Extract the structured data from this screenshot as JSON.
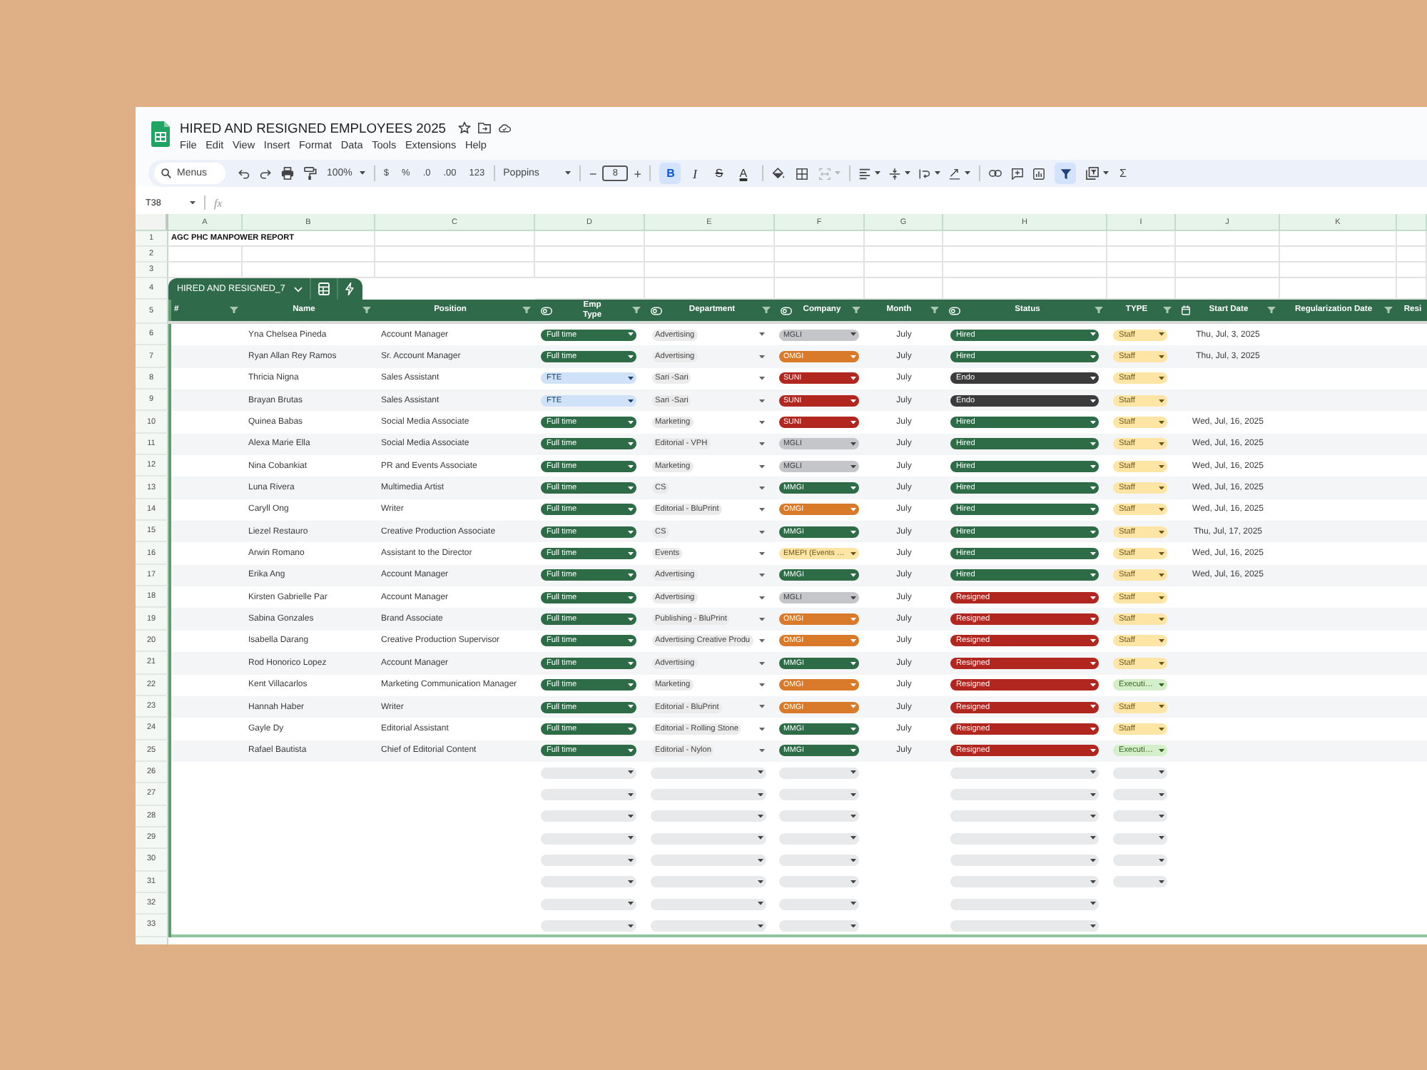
{
  "window": {
    "title": "HIRED AND RESIGNED EMPLOYEES 2025"
  },
  "menu": [
    "File",
    "Edit",
    "View",
    "Insert",
    "Format",
    "Data",
    "Tools",
    "Extensions",
    "Help"
  ],
  "toolbar": {
    "search": {
      "placeholder": "Menus"
    },
    "zoom": "100%",
    "currency": "$",
    "percent": "%",
    "decimal_decrease": ".0",
    "decimal_increase": ".00",
    "number_format": "123",
    "font": "Poppins",
    "minus": "−",
    "font_size": "8",
    "plus": "+",
    "format_buttons": [
      {
        "label": "B",
        "kind": "bold",
        "selected": true
      },
      {
        "label": "I",
        "kind": "italic",
        "selected": false
      },
      {
        "label": "S",
        "kind": "strike",
        "selected": false
      },
      {
        "label": "A",
        "kind": "color",
        "selected": false
      }
    ],
    "merge": {
      "disabled": true
    },
    "filter": {
      "selected": true
    },
    "sum": "Σ"
  },
  "formula_bar": {
    "cell": "T38",
    "fx": "fx"
  },
  "sheet": {
    "columns": [
      "A",
      "B",
      "C",
      "D",
      "E",
      "F",
      "G",
      "H",
      "I",
      "J",
      "K"
    ],
    "title_row": {
      "number": "1",
      "text": "AGC PHC MANPOWER REPORT"
    },
    "empty_rows": [
      "2",
      "3"
    ],
    "table": {
      "tab_row": "4",
      "name": "HIRED AND RESIGNED_7",
      "header_row": "5",
      "headers": [
        {
          "label": "#",
          "kind": "plain",
          "filter": true
        },
        {
          "label": "Name",
          "kind": "plain",
          "filter": true
        },
        {
          "label": "Position",
          "kind": "plain",
          "filter": true
        },
        {
          "label": "Emp Type",
          "kind": "dropdown",
          "filter": true
        },
        {
          "label": "Department",
          "kind": "dropdown",
          "filter": true
        },
        {
          "label": "Company",
          "kind": "dropdown",
          "filter": true
        },
        {
          "label": "Month",
          "kind": "plain",
          "filter": true
        },
        {
          "label": "Status",
          "kind": "dropdown",
          "filter": true
        },
        {
          "label": "TYPE",
          "kind": "plain",
          "filter": true
        },
        {
          "label": "Start Date",
          "kind": "date",
          "filter": true
        },
        {
          "label": "Regularization Date",
          "kind": "plain",
          "filter": true
        },
        {
          "label": "Resi",
          "kind": "plain",
          "filter": false
        }
      ],
      "rows": [
        {
          "number": "6",
          "kind": "entry",
          "name": "Yna Chelsea Pineda",
          "position": "Account Manager",
          "emp_type": {
            "text": "Full time",
            "color": "#2e6c48"
          },
          "department": "Advertising",
          "company": {
            "text": "MGLI",
            "color": "#c5c6c9"
          },
          "month": "July",
          "status": {
            "text": "Hired",
            "color": "#2e6c48"
          },
          "type": {
            "text": "Staff",
            "color": "#fde6a5"
          },
          "start_date": "Thu, Jul, 3, 2025"
        },
        {
          "number": "7",
          "kind": "entry",
          "name": "Ryan Allan Rey Ramos",
          "position": "Sr. Account Manager",
          "emp_type": {
            "text": "Full time",
            "color": "#2e6c48"
          },
          "department": "Advertising",
          "company": {
            "text": "OMGI",
            "color": "#d97a2b"
          },
          "month": "July",
          "status": {
            "text": "Hired",
            "color": "#2e6c48"
          },
          "type": {
            "text": "Staff",
            "color": "#fde6a5"
          },
          "start_date": "Thu, Jul, 3, 2025"
        },
        {
          "number": "8",
          "kind": "entry",
          "name": "Thricia Nigna",
          "position": "Sales Assistant",
          "emp_type": {
            "text": "FTE",
            "color": "#cfe2f8"
          },
          "department": "Sari -Sari",
          "company": {
            "text": "SUNI",
            "color": "#b1261f"
          },
          "month": "July",
          "status": {
            "text": "Endo",
            "color": "#3b3b3b"
          },
          "type": {
            "text": "Staff",
            "color": "#fde6a5"
          }
        },
        {
          "number": "9",
          "kind": "entry",
          "name": "Brayan Brutas",
          "position": "Sales Assistant",
          "emp_type": {
            "text": "FTE",
            "color": "#cfe2f8"
          },
          "department": "Sari -Sari",
          "company": {
            "text": "SUNI",
            "color": "#b1261f"
          },
          "month": "July",
          "status": {
            "text": "Endo",
            "color": "#3b3b3b"
          },
          "type": {
            "text": "Staff",
            "color": "#fde6a5"
          }
        },
        {
          "number": "10",
          "kind": "entry",
          "name": "Quinea Babas",
          "position": "Social Media Associate",
          "emp_type": {
            "text": "Full time",
            "color": "#2e6c48"
          },
          "department": "Marketing",
          "company": {
            "text": "SUNI",
            "color": "#b1261f"
          },
          "month": "July",
          "status": {
            "text": "Hired",
            "color": "#2e6c48"
          },
          "type": {
            "text": "Staff",
            "color": "#fde6a5"
          },
          "start_date": "Wed, Jul, 16, 2025"
        },
        {
          "number": "11",
          "kind": "entry",
          "name": "Alexa Marie Ella",
          "position": "Social Media Associate",
          "emp_type": {
            "text": "Full time",
            "color": "#2e6c48"
          },
          "department": "Editorial - VPH",
          "company": {
            "text": "MGLI",
            "color": "#c5c6c9"
          },
          "month": "July",
          "status": {
            "text": "Hired",
            "color": "#2e6c48"
          },
          "type": {
            "text": "Staff",
            "color": "#fde6a5"
          },
          "start_date": "Wed, Jul, 16, 2025"
        },
        {
          "number": "12",
          "kind": "entry",
          "name": "Nina Cobankiat",
          "position": "PR and Events Associate",
          "emp_type": {
            "text": "Full time",
            "color": "#2e6c48"
          },
          "department": "Marketing",
          "company": {
            "text": "MGLI",
            "color": "#c5c6c9"
          },
          "month": "July",
          "status": {
            "text": "Hired",
            "color": "#2e6c48"
          },
          "type": {
            "text": "Staff",
            "color": "#fde6a5"
          },
          "start_date": "Wed, Jul, 16, 2025"
        },
        {
          "number": "13",
          "kind": "entry",
          "name": "Luna Rivera",
          "position": "Multimedia Artist",
          "emp_type": {
            "text": "Full time",
            "color": "#2e6c48"
          },
          "department": "CS",
          "company": {
            "text": "MMGI",
            "color": "#2e6c48"
          },
          "month": "July",
          "status": {
            "text": "Hired",
            "color": "#2e6c48"
          },
          "type": {
            "text": "Staff",
            "color": "#fde6a5"
          },
          "start_date": "Wed, Jul, 16, 2025"
        },
        {
          "number": "14",
          "kind": "entry",
          "name": "Caryll Ong",
          "position": "Writer",
          "emp_type": {
            "text": "Full time",
            "color": "#2e6c48"
          },
          "department": "Editorial - BluPrint",
          "company": {
            "text": "OMGI",
            "color": "#d97a2b"
          },
          "month": "July",
          "status": {
            "text": "Hired",
            "color": "#2e6c48"
          },
          "type": {
            "text": "Staff",
            "color": "#fde6a5"
          },
          "start_date": "Wed, Jul, 16, 2025"
        },
        {
          "number": "15",
          "kind": "entry",
          "name": "Liezel Restauro",
          "position": "Creative Production Associate",
          "emp_type": {
            "text": "Full time",
            "color": "#2e6c48"
          },
          "department": "CS",
          "company": {
            "text": "MMGI",
            "color": "#2e6c48"
          },
          "month": "July",
          "status": {
            "text": "Hired",
            "color": "#2e6c48"
          },
          "type": {
            "text": "Staff",
            "color": "#fde6a5"
          },
          "start_date": "Thu, Jul, 17, 2025"
        },
        {
          "number": "16",
          "kind": "entry",
          "name": "Arwin Romano",
          "position": "Assistant to the Director",
          "emp_type": {
            "text": "Full time",
            "color": "#2e6c48"
          },
          "department": "Events",
          "company": {
            "text": "EMEPI (Events …",
            "color": "#fde6a5"
          },
          "month": "July",
          "status": {
            "text": "Hired",
            "color": "#2e6c48"
          },
          "type": {
            "text": "Staff",
            "color": "#fde6a5"
          },
          "start_date": "Wed, Jul, 16, 2025"
        },
        {
          "number": "17",
          "kind": "entry",
          "name": "Erika Ang",
          "position": "Account Manager",
          "emp_type": {
            "text": "Full time",
            "color": "#2e6c48"
          },
          "department": "Advertising",
          "company": {
            "text": "MMGI",
            "color": "#2e6c48"
          },
          "month": "July",
          "status": {
            "text": "Hired",
            "color": "#2e6c48"
          },
          "type": {
            "text": "Staff",
            "color": "#fde6a5"
          },
          "start_date": "Wed, Jul, 16, 2025"
        },
        {
          "number": "18",
          "kind": "entry",
          "name": "Kirsten Gabrielle Par",
          "position": "Account Manager",
          "emp_type": {
            "text": "Full time",
            "color": "#2e6c48"
          },
          "department": "Advertising",
          "company": {
            "text": "MGLI",
            "color": "#c5c6c9"
          },
          "month": "July",
          "status": {
            "text": "Resigned",
            "color": "#b1261f"
          },
          "type": {
            "text": "Staff",
            "color": "#fde6a5"
          }
        },
        {
          "number": "19",
          "kind": "entry",
          "name": "Sabina Gonzales",
          "position": "Brand Associate",
          "emp_type": {
            "text": "Full time",
            "color": "#2e6c48"
          },
          "department": "Publishing - BluPrint",
          "company": {
            "text": "OMGI",
            "color": "#d97a2b"
          },
          "month": "July",
          "status": {
            "text": "Resigned",
            "color": "#b1261f"
          },
          "type": {
            "text": "Staff",
            "color": "#fde6a5"
          }
        },
        {
          "number": "20",
          "kind": "entry",
          "name": "Isabella Darang",
          "position": "Creative Production Supervisor",
          "emp_type": {
            "text": "Full time",
            "color": "#2e6c48"
          },
          "department": "Advertising Creative Produ",
          "company": {
            "text": "OMGI",
            "color": "#d97a2b"
          },
          "month": "July",
          "status": {
            "text": "Resigned",
            "color": "#b1261f"
          },
          "type": {
            "text": "Staff",
            "color": "#fde6a5"
          }
        },
        {
          "number": "21",
          "kind": "entry",
          "name": "Rod Honorico Lopez",
          "position": "Account Manager",
          "emp_type": {
            "text": "Full time",
            "color": "#2e6c48"
          },
          "department": "Advertising",
          "company": {
            "text": "MMGI",
            "color": "#2e6c48"
          },
          "month": "July",
          "status": {
            "text": "Resigned",
            "color": "#b1261f"
          },
          "type": {
            "text": "Staff",
            "color": "#fde6a5"
          }
        },
        {
          "number": "22",
          "kind": "entry",
          "name": "Kent Villacarlos",
          "position": "Marketing Communication Manager",
          "emp_type": {
            "text": "Full time",
            "color": "#2e6c48"
          },
          "department": "Marketing",
          "company": {
            "text": "OMGI",
            "color": "#d97a2b"
          },
          "month": "July",
          "status": {
            "text": "Resigned",
            "color": "#b1261f"
          },
          "type": {
            "text": "Executi…",
            "color": "#d6efcb"
          }
        },
        {
          "number": "23",
          "kind": "entry",
          "name": "Hannah Haber",
          "position": "Writer",
          "emp_type": {
            "text": "Full time",
            "color": "#2e6c48"
          },
          "department": "Editorial - BluPrint",
          "company": {
            "text": "OMGI",
            "color": "#d97a2b"
          },
          "month": "July",
          "status": {
            "text": "Resigned",
            "color": "#b1261f"
          },
          "type": {
            "text": "Staff",
            "color": "#fde6a5"
          }
        },
        {
          "number": "24",
          "kind": "entry",
          "name": "Gayle Dy",
          "position": "Editorial Assistant",
          "emp_type": {
            "text": "Full time",
            "color": "#2e6c48"
          },
          "department": "Editorial - Rolling Stone",
          "company": {
            "text": "MMGI",
            "color": "#2e6c48"
          },
          "month": "July",
          "status": {
            "text": "Resigned",
            "color": "#b1261f"
          },
          "type": {
            "text": "Staff",
            "color": "#fde6a5"
          }
        },
        {
          "number": "25",
          "kind": "entry",
          "name": "Rafael Bautista",
          "position": "Chief of Editorial Content",
          "emp_type": {
            "text": "Full time",
            "color": "#2e6c48"
          },
          "department": "Editorial - Nylon",
          "company": {
            "text": "MMGI",
            "color": "#2e6c48"
          },
          "month": "July",
          "status": {
            "text": "Resigned",
            "color": "#b1261f"
          },
          "type": {
            "text": "Executi…",
            "color": "#d6efcb"
          }
        },
        {
          "number": "26",
          "kind": "blank",
          "type_field": true
        },
        {
          "number": "27",
          "kind": "blank",
          "type_field": true
        },
        {
          "number": "28",
          "kind": "blank",
          "type_field": true
        },
        {
          "number": "29",
          "kind": "blank",
          "type_field": true
        },
        {
          "number": "30",
          "kind": "blank",
          "type_field": true
        },
        {
          "number": "31",
          "kind": "blank",
          "type_field": true
        },
        {
          "number": "32",
          "kind": "blank",
          "type_field": false
        },
        {
          "number": "33",
          "kind": "blank",
          "type_field": false
        }
      ]
    }
  }
}
